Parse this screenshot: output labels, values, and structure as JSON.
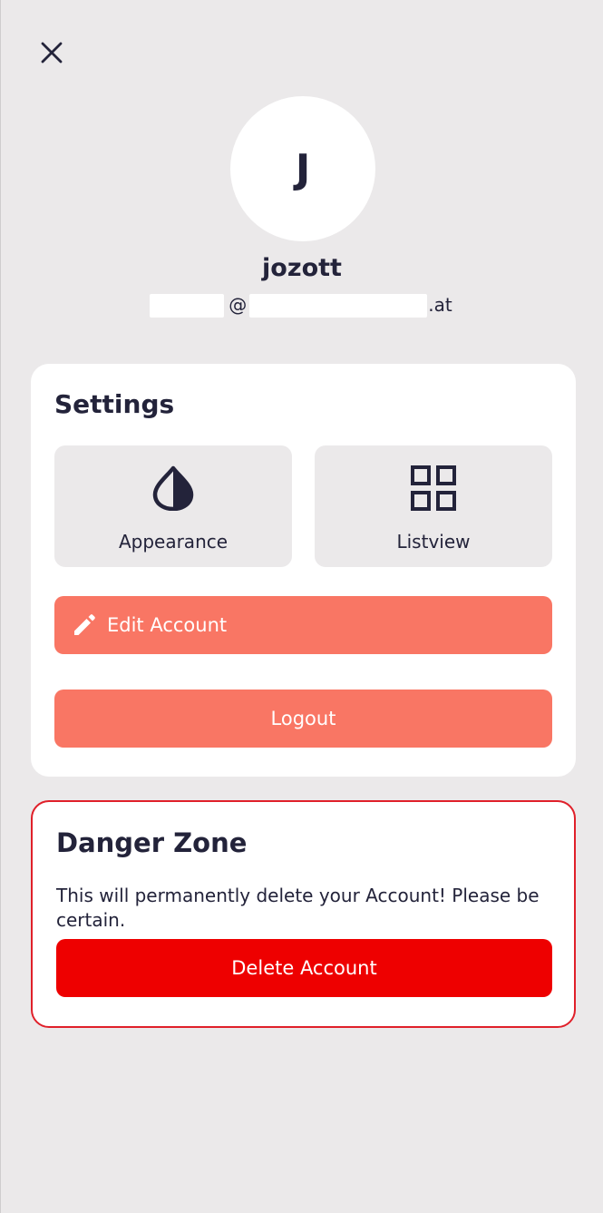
{
  "header": {
    "close_icon": "close-icon"
  },
  "profile": {
    "avatar_initial": "J",
    "username": "jozott",
    "email_visible": "@",
    "email_suffix": ".at"
  },
  "settings": {
    "title": "Settings",
    "tiles": [
      {
        "label": "Appearance",
        "icon": "water-drop-icon"
      },
      {
        "label": "Listview",
        "icon": "grid-icon"
      }
    ],
    "edit_account_label": "Edit Account",
    "edit_account_icon": "pencil-icon",
    "logout_label": "Logout"
  },
  "danger_zone": {
    "title": "Danger Zone",
    "description": "This will permanently delete your Account! Please be certain.",
    "delete_label": "Delete Account"
  },
  "colors": {
    "background": "#ebe9ea",
    "accent": "#f97664",
    "danger": "#ee0000",
    "text": "#23233a"
  }
}
